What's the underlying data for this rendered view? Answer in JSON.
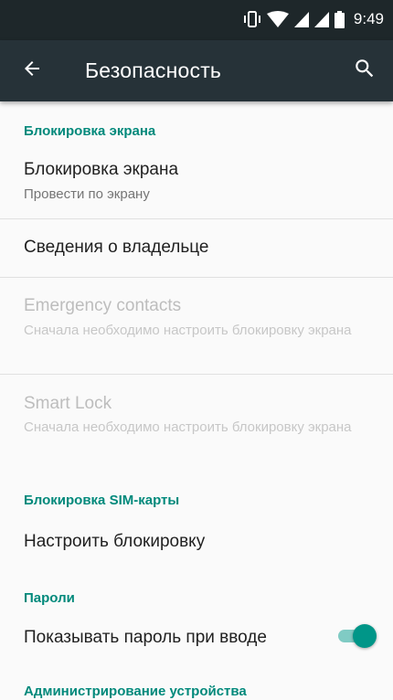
{
  "status_bar": {
    "time": "9:49",
    "icons": [
      "vibrate-icon",
      "wifi-icon",
      "signal-icon",
      "signal-icon",
      "battery-icon"
    ]
  },
  "app_bar": {
    "title": "Безопасность",
    "back_icon": "arrow-back-icon",
    "search_icon": "search-icon",
    "background": "#263238"
  },
  "sections": {
    "screen_lock": {
      "header": "Блокировка экрана",
      "lock_item": {
        "title": "Блокировка экрана",
        "summary": "Провести по экрану"
      },
      "owner_info": {
        "title": "Сведения о владельце"
      },
      "emergency": {
        "title": "Emergency contacts",
        "summary": "Сначала необходимо настроить блокировку экрана",
        "enabled": false
      },
      "smart_lock": {
        "title": "Smart Lock",
        "summary": "Сначала необходимо настроить блокировку экрана",
        "enabled": false
      }
    },
    "sim_lock": {
      "header": "Блокировка SIM-карты",
      "setup": {
        "title": "Настроить блокировку"
      }
    },
    "passwords": {
      "header": "Пароли",
      "show_password": {
        "title": "Показывать пароль при вводе",
        "checked": true
      }
    },
    "device_admin": {
      "header": "Администрирование устройства"
    }
  },
  "colors": {
    "accent": "#009688",
    "category": "#00897b",
    "status_bar": "#1e272a"
  }
}
